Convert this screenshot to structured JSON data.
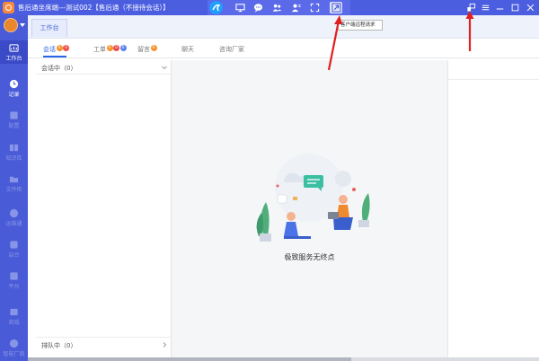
{
  "window": {
    "title": "售后通坐席端---测试002【售后通（不接待会话）】"
  },
  "toolbar": {
    "icons": [
      "app-logo-icon",
      "monitor-icon",
      "chat-bubble-icon",
      "group-icon",
      "contacts-icon",
      "fullscreen-icon",
      "remote-link-icon"
    ],
    "tooltip": "客户端远程请求"
  },
  "window_controls": [
    "remote-icon",
    "menu-icon",
    "minimize-icon",
    "maximize-icon",
    "close-icon"
  ],
  "nav": {
    "items": [
      {
        "label": "工作台",
        "icon": "workbench-icon",
        "active": true
      },
      {
        "label": "记录",
        "icon": "clock-icon",
        "active": false
      },
      {
        "label": "配置",
        "icon": "settings-icon",
        "active": false
      },
      {
        "label": "知识库",
        "icon": "book-icon",
        "active": false
      },
      {
        "label": "文件柜",
        "icon": "folder-icon",
        "active": false
      },
      {
        "label": "运维通",
        "icon": "ops-icon",
        "active": false
      },
      {
        "label": "启台",
        "icon": "launch-icon",
        "active": false
      },
      {
        "label": "平台",
        "icon": "platform-icon",
        "active": false
      },
      {
        "label": "商城",
        "icon": "store-icon",
        "active": false
      },
      {
        "label": "智能厂商",
        "icon": "vendor-icon",
        "active": false
      }
    ]
  },
  "workspace": {
    "tab": "工作台",
    "subtabs": [
      {
        "label": "会话",
        "badges": [
          "0",
          "0"
        ],
        "active": true
      },
      {
        "label": "工单",
        "badges": [
          "0",
          "0",
          "0"
        ],
        "active": false
      },
      {
        "label": "留言",
        "badges": [
          "0"
        ],
        "active": false
      },
      {
        "label": "聊天",
        "badges": [],
        "active": false
      },
      {
        "label": "咨询厂家",
        "badges": [],
        "active": false
      }
    ]
  },
  "list": {
    "session_header": "会话中（0）",
    "queue_row": "排队中（0）"
  },
  "empty_state": {
    "caption": "极致服务无终点"
  },
  "colors": {
    "brand": "#4a5bd8",
    "accent": "#2a64e8",
    "badge_orange": "#f5922b",
    "badge_red": "#ef4a4a",
    "badge_blue": "#5a7ff0",
    "annotation": "#e02020"
  }
}
